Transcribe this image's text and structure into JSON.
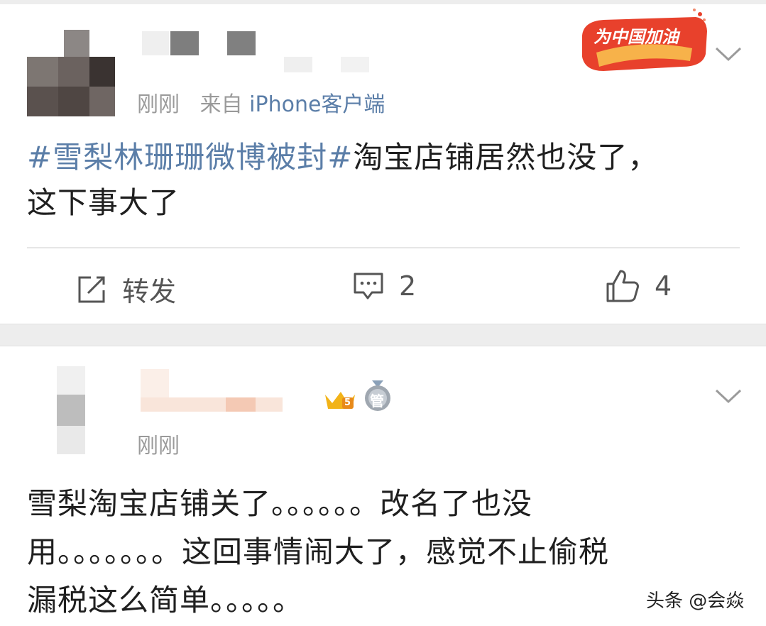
{
  "post1": {
    "time": "刚刚",
    "source_prefix": "来自",
    "source_app": "iPhone客户端",
    "badge_text": "为中国加油",
    "topic": "#雪梨林珊珊微博被封#",
    "text_line1": "淘宝店铺居然也没了，",
    "text_line2": "这下事大了",
    "repost_label": "转发",
    "comment_count": "2",
    "like_count": "4"
  },
  "post2": {
    "time": "刚刚",
    "level_badge": "5",
    "medal_badge": "管",
    "lines": [
      "雪梨淘宝店铺关了。。。。。。改名了也没",
      "用。。。。。。。这回事情闹大了，感觉不止偷税",
      "漏税这么简单。。。。。"
    ]
  },
  "watermark": "头条 @会焱",
  "colors": {
    "link": "#5b7ea8",
    "meta": "#9a9a9a",
    "divider": "#e6e6e6",
    "band": "#ededed",
    "badge_red": "#e8412c"
  },
  "icons": [
    "repost-icon",
    "comment-icon",
    "like-icon",
    "chevron-down-icon"
  ]
}
